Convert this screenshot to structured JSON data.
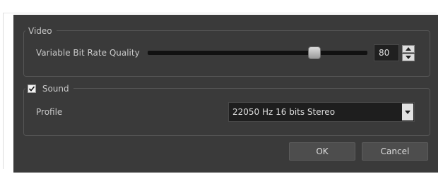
{
  "video": {
    "group_title": "Video",
    "bitrate_label": "Variable Bit Rate Quality",
    "bitrate_value": "80",
    "bitrate_slider_fraction": 0.76
  },
  "sound": {
    "group_title": "Sound",
    "enabled": true,
    "profile_label": "Profile",
    "profile_value": "22050 Hz 16 bits Stereo"
  },
  "buttons": {
    "ok": "OK",
    "cancel": "Cancel"
  },
  "colors": {
    "dialog_bg": "#3a3a3a",
    "field_bg": "#1e1e1e",
    "text": "#c8c8c8"
  },
  "icons": {
    "spin_up": "triangle-up-icon",
    "spin_down": "triangle-down-icon",
    "dropdown": "triangle-down-icon",
    "check": "checkmark-icon"
  }
}
